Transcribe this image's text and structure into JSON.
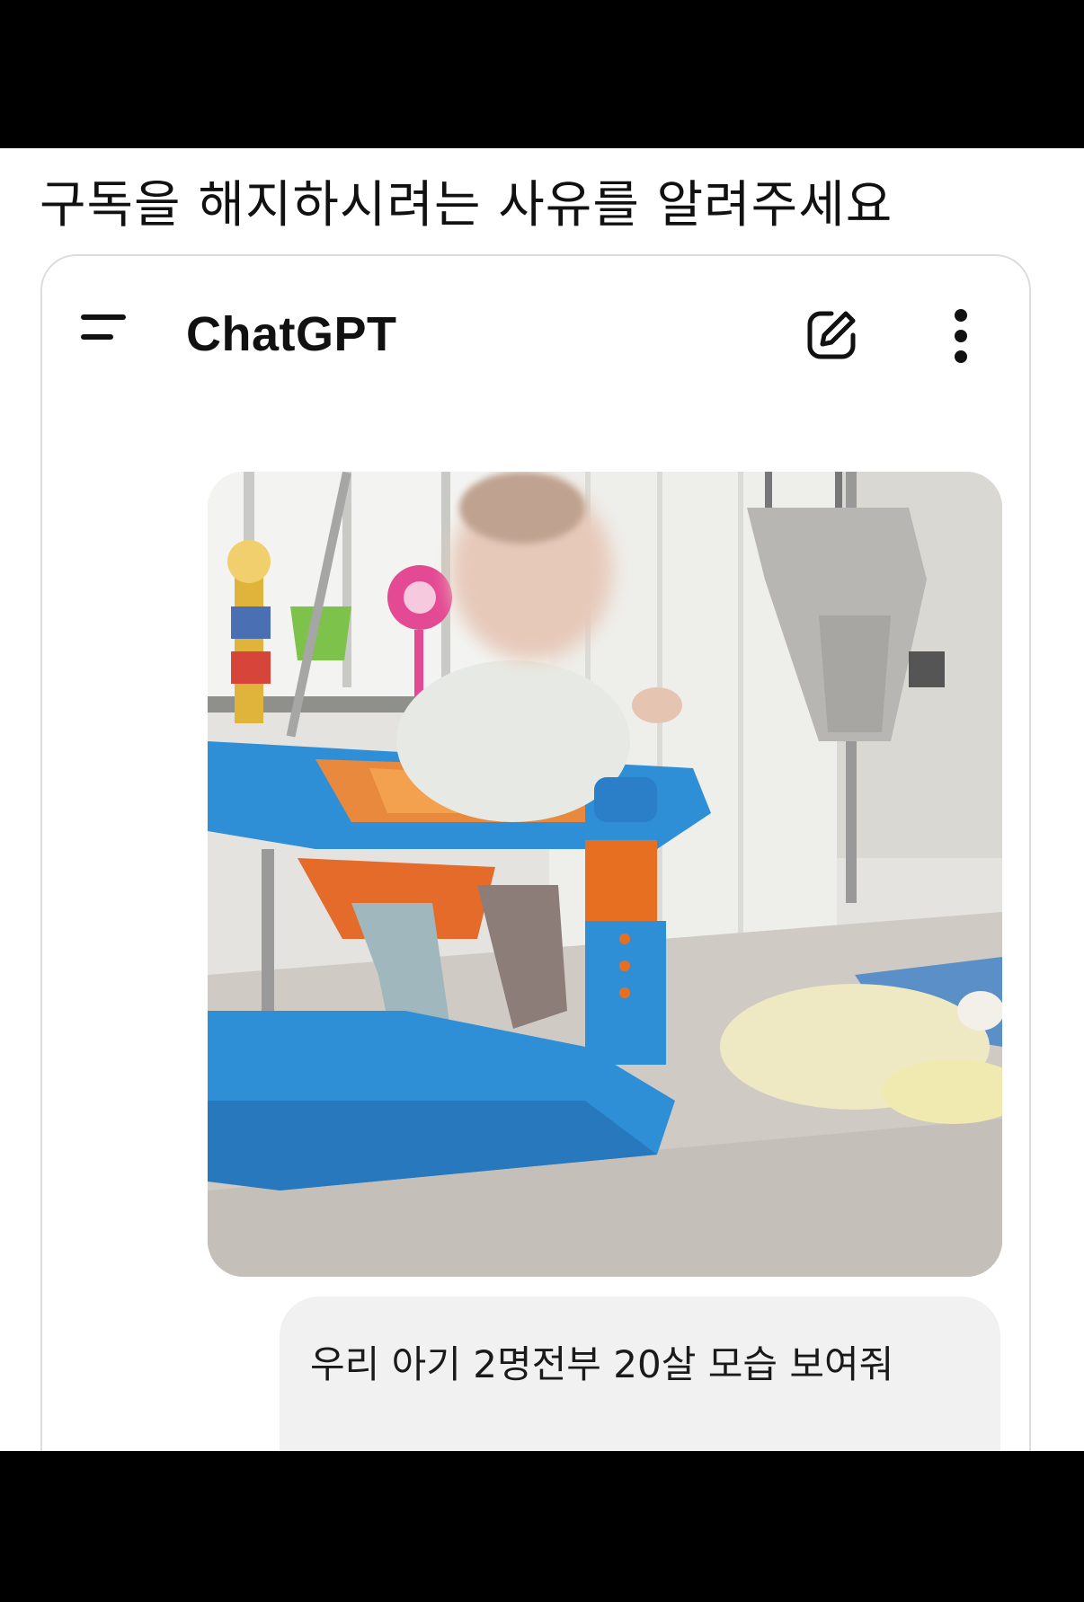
{
  "caption": "구독을 해지하시려는 사유를 알려주세요",
  "app": {
    "title": "ChatGPT",
    "icons": {
      "menu": "menu-icon",
      "new_chat": "edit-icon",
      "more": "more-vertical-icon"
    }
  },
  "message": {
    "attachment": "photo",
    "text": "우리 아기 2명전부 20살 모습 보여줘"
  }
}
